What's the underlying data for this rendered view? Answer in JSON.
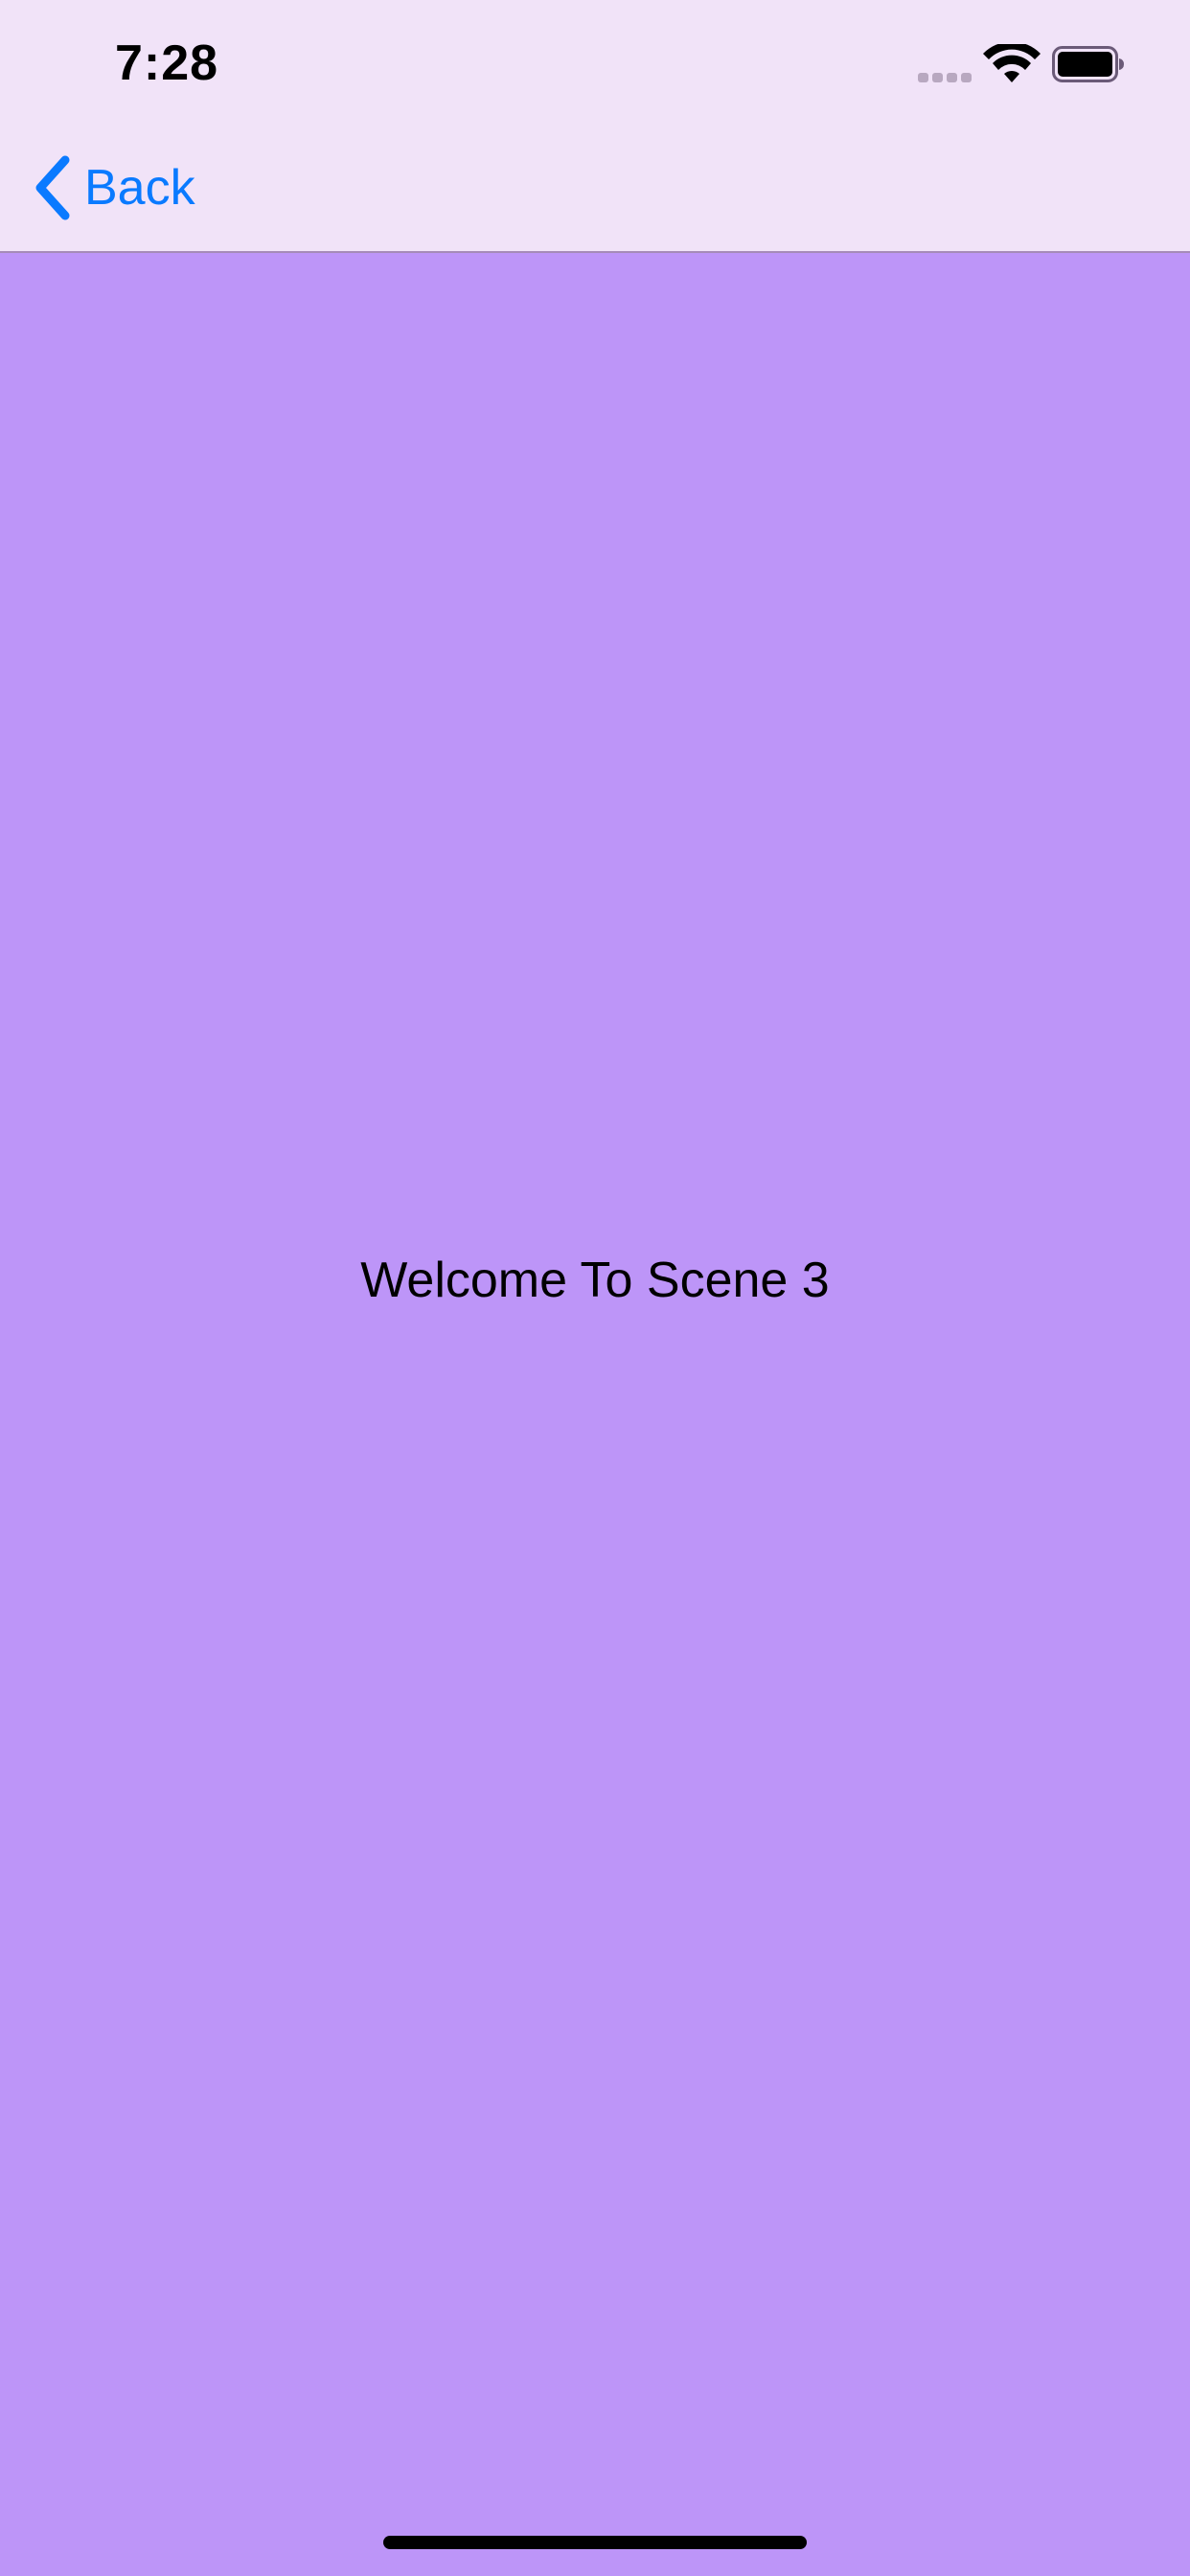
{
  "status_bar": {
    "time": "7:28",
    "icons": [
      "cellular-signal-icon",
      "wifi-icon",
      "battery-icon"
    ]
  },
  "nav_bar": {
    "back_label": "Back",
    "back_icon": "chevron-left-icon"
  },
  "content": {
    "message": "Welcome To Scene 3"
  },
  "colors": {
    "background": "#bd95f8",
    "nav_background": "#f1e3f8",
    "accent": "#0a7aff",
    "text": "#000000"
  }
}
